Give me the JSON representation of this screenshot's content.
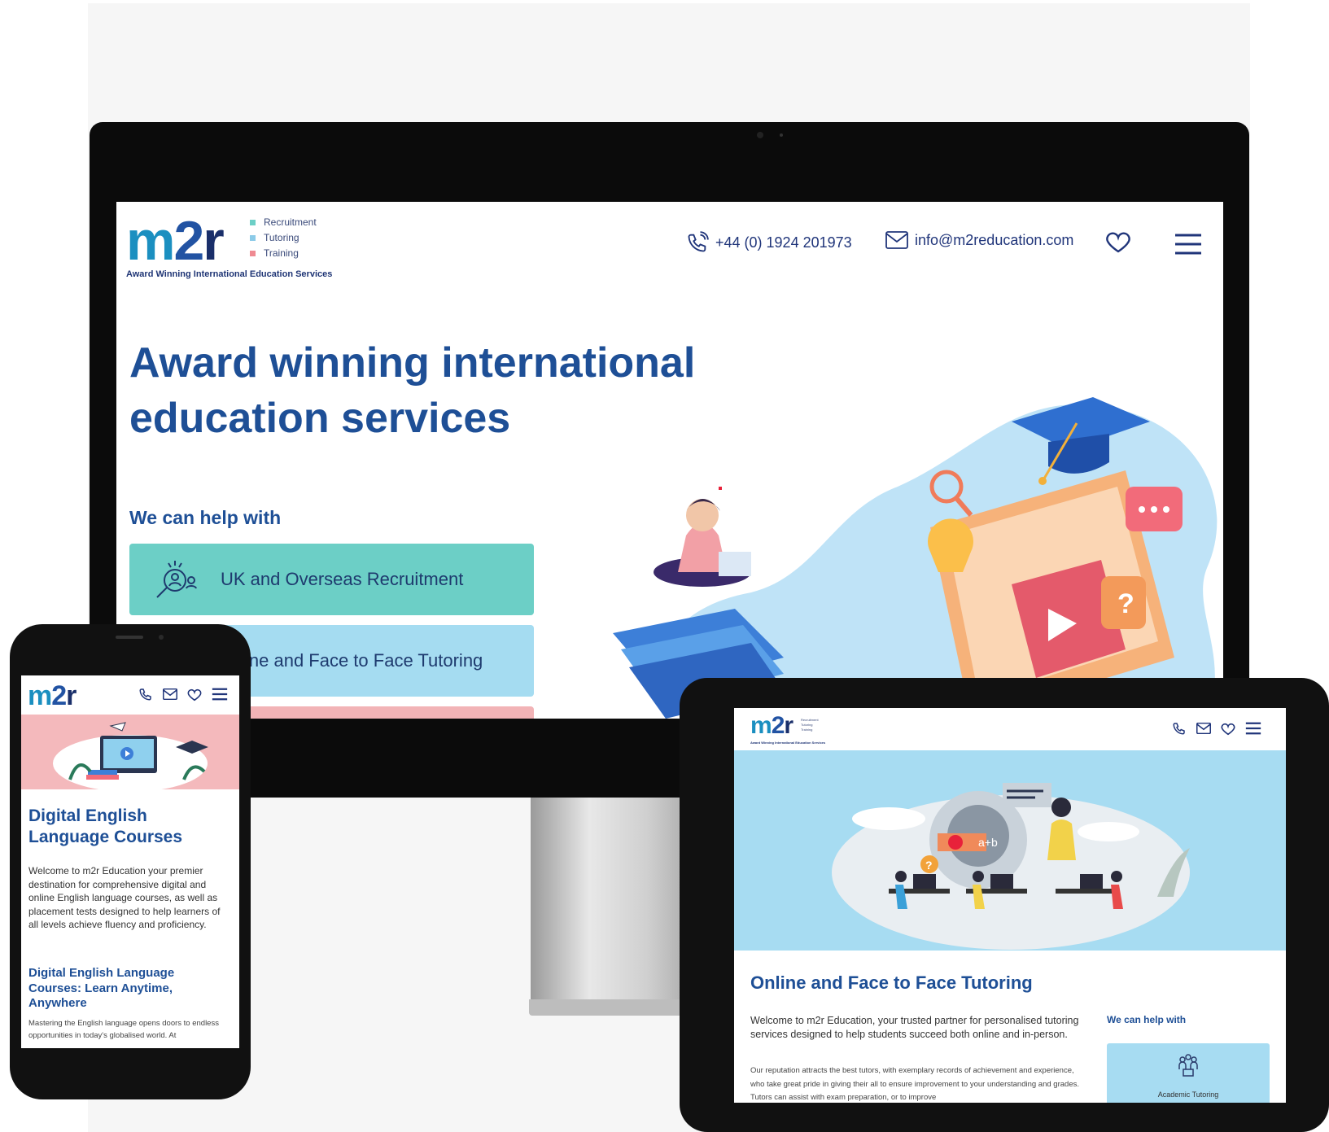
{
  "desktop": {
    "logo": {
      "brand_m": "m",
      "brand_2": "2",
      "brand_r": "r",
      "taglines": [
        "Recruitment",
        "Tutoring",
        "Training"
      ],
      "subline": "Award Winning International Education Services"
    },
    "header": {
      "phone": "+44 (0) 1924 201973",
      "email": "info@m2reducation.com",
      "phone_icon": "phone-icon",
      "email_icon": "envelope-icon",
      "heart_icon": "heart-icon",
      "menu_icon": "hamburger-menu-icon"
    },
    "hero_title": "Award winning international education services",
    "help_heading": "We can help with",
    "services": [
      {
        "label": "UK and Overseas Recruitment",
        "icon": "recruitment-search-icon",
        "color": "#6ccfc6"
      },
      {
        "label": "ine and Face to Face Tutoring",
        "color": "#a5dcf1"
      },
      {
        "label": "",
        "color": "#f2b3b6"
      }
    ]
  },
  "phone": {
    "logo": "m2r",
    "title": "Digital English Language Courses",
    "intro": "Welcome to m2r Education your premier destination for comprehensive digital and online English language courses, as well as placement tests designed to help learners of all levels achieve fluency and proficiency.",
    "subtitle": "Digital English Language Courses: Learn Anytime, Anywhere",
    "body": "Mastering the English language opens doors to endless opportunities in today's globalised world. At"
  },
  "tablet": {
    "logo_m": "m",
    "logo_2": "2",
    "logo_r": "r",
    "title": "Online and Face to Face Tutoring",
    "intro": "Welcome to m2r Education, your trusted partner for personalised tutoring services designed to help students succeed both online and in-person.",
    "body": "Our reputation attracts the best tutors, with exemplary records of achievement and experience, who take great pride in giving their all to ensure improvement to your understanding and grades. Tutors can assist with exam preparation, or to improve",
    "help_heading": "We can help with",
    "card_label": "Academic Tutoring"
  },
  "colors": {
    "brand_blue": "#1e4f96",
    "teal": "#6ccfc6",
    "light_blue": "#a5dcf1",
    "pink": "#f2b3b6"
  }
}
